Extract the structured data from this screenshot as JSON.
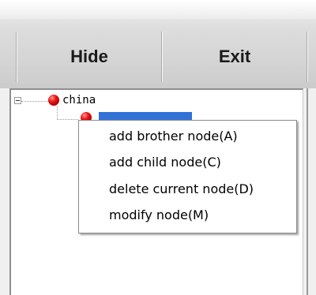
{
  "toolbar": {
    "hide_label": "Hide",
    "exit_label": "Exit"
  },
  "tree": {
    "root": {
      "label": "china",
      "icon": "red-ball-icon",
      "expanded": true
    },
    "child": {
      "label": "",
      "selected": true,
      "selection_color": "#3172d6"
    }
  },
  "context_menu": {
    "items": [
      {
        "label": "add brother node(A)"
      },
      {
        "label": "add child node(C)"
      },
      {
        "label": "delete current node(D)"
      },
      {
        "label": "modify node(M)"
      }
    ]
  }
}
